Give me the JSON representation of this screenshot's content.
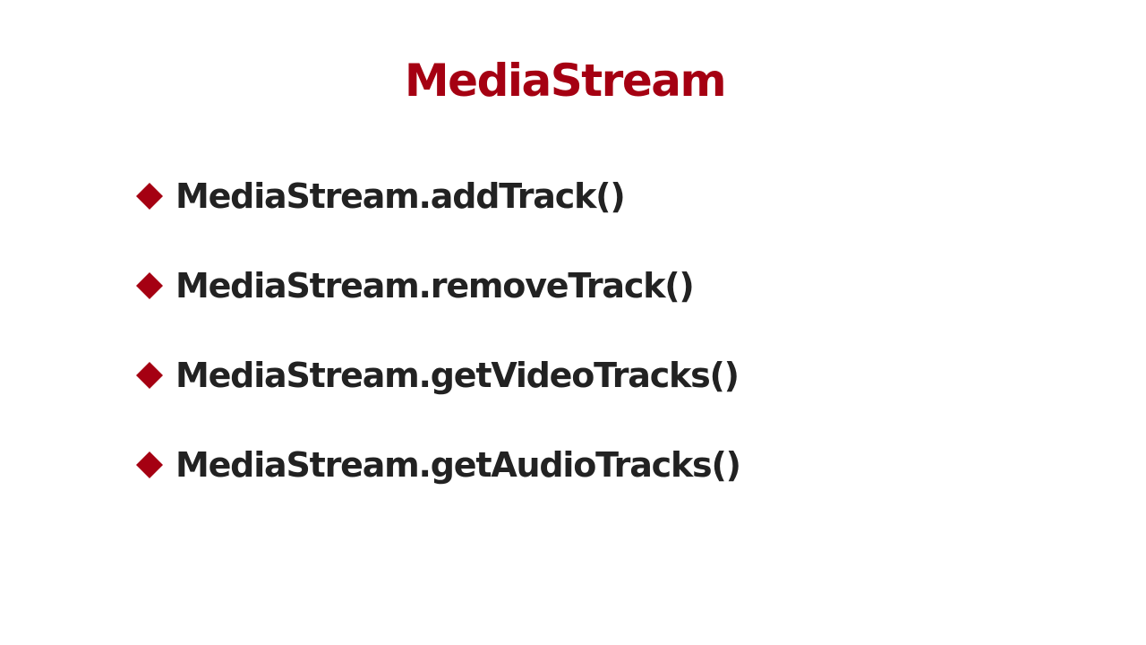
{
  "slide": {
    "title": "MediaStream",
    "bullet_icon": "diamond-icon",
    "accent_color": "#a50012",
    "text_color": "#222222",
    "items": [
      {
        "label": "MediaStream.addTrack()"
      },
      {
        "label": "MediaStream.removeTrack()"
      },
      {
        "label": "MediaStream.getVideoTracks()"
      },
      {
        "label": "MediaStream.getAudioTracks()"
      }
    ]
  }
}
